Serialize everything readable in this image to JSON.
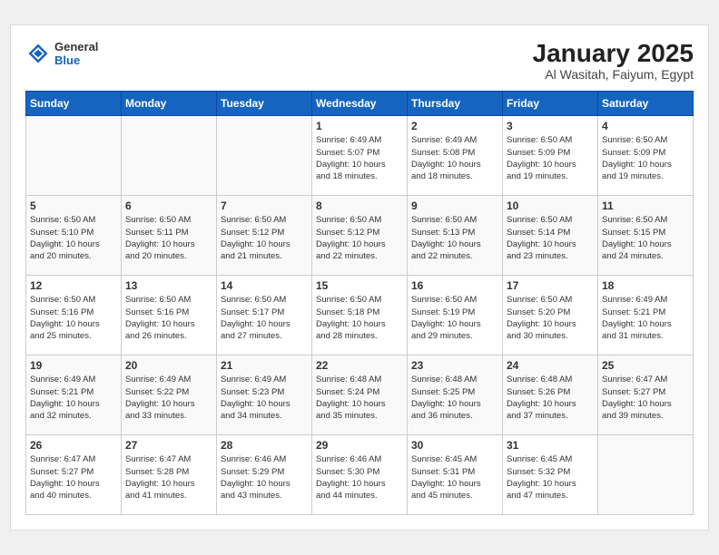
{
  "header": {
    "logo": {
      "general": "General",
      "blue": "Blue"
    },
    "title": "January 2025",
    "location": "Al Wasitah, Faiyum, Egypt"
  },
  "weekdays": [
    "Sunday",
    "Monday",
    "Tuesday",
    "Wednesday",
    "Thursday",
    "Friday",
    "Saturday"
  ],
  "weeks": [
    [
      {
        "day": "",
        "info": ""
      },
      {
        "day": "",
        "info": ""
      },
      {
        "day": "",
        "info": ""
      },
      {
        "day": "1",
        "info": "Sunrise: 6:49 AM\nSunset: 5:07 PM\nDaylight: 10 hours\nand 18 minutes."
      },
      {
        "day": "2",
        "info": "Sunrise: 6:49 AM\nSunset: 5:08 PM\nDaylight: 10 hours\nand 18 minutes."
      },
      {
        "day": "3",
        "info": "Sunrise: 6:50 AM\nSunset: 5:09 PM\nDaylight: 10 hours\nand 19 minutes."
      },
      {
        "day": "4",
        "info": "Sunrise: 6:50 AM\nSunset: 5:09 PM\nDaylight: 10 hours\nand 19 minutes."
      }
    ],
    [
      {
        "day": "5",
        "info": "Sunrise: 6:50 AM\nSunset: 5:10 PM\nDaylight: 10 hours\nand 20 minutes."
      },
      {
        "day": "6",
        "info": "Sunrise: 6:50 AM\nSunset: 5:11 PM\nDaylight: 10 hours\nand 20 minutes."
      },
      {
        "day": "7",
        "info": "Sunrise: 6:50 AM\nSunset: 5:12 PM\nDaylight: 10 hours\nand 21 minutes."
      },
      {
        "day": "8",
        "info": "Sunrise: 6:50 AM\nSunset: 5:12 PM\nDaylight: 10 hours\nand 22 minutes."
      },
      {
        "day": "9",
        "info": "Sunrise: 6:50 AM\nSunset: 5:13 PM\nDaylight: 10 hours\nand 22 minutes."
      },
      {
        "day": "10",
        "info": "Sunrise: 6:50 AM\nSunset: 5:14 PM\nDaylight: 10 hours\nand 23 minutes."
      },
      {
        "day": "11",
        "info": "Sunrise: 6:50 AM\nSunset: 5:15 PM\nDaylight: 10 hours\nand 24 minutes."
      }
    ],
    [
      {
        "day": "12",
        "info": "Sunrise: 6:50 AM\nSunset: 5:16 PM\nDaylight: 10 hours\nand 25 minutes."
      },
      {
        "day": "13",
        "info": "Sunrise: 6:50 AM\nSunset: 5:16 PM\nDaylight: 10 hours\nand 26 minutes."
      },
      {
        "day": "14",
        "info": "Sunrise: 6:50 AM\nSunset: 5:17 PM\nDaylight: 10 hours\nand 27 minutes."
      },
      {
        "day": "15",
        "info": "Sunrise: 6:50 AM\nSunset: 5:18 PM\nDaylight: 10 hours\nand 28 minutes."
      },
      {
        "day": "16",
        "info": "Sunrise: 6:50 AM\nSunset: 5:19 PM\nDaylight: 10 hours\nand 29 minutes."
      },
      {
        "day": "17",
        "info": "Sunrise: 6:50 AM\nSunset: 5:20 PM\nDaylight: 10 hours\nand 30 minutes."
      },
      {
        "day": "18",
        "info": "Sunrise: 6:49 AM\nSunset: 5:21 PM\nDaylight: 10 hours\nand 31 minutes."
      }
    ],
    [
      {
        "day": "19",
        "info": "Sunrise: 6:49 AM\nSunset: 5:21 PM\nDaylight: 10 hours\nand 32 minutes."
      },
      {
        "day": "20",
        "info": "Sunrise: 6:49 AM\nSunset: 5:22 PM\nDaylight: 10 hours\nand 33 minutes."
      },
      {
        "day": "21",
        "info": "Sunrise: 6:49 AM\nSunset: 5:23 PM\nDaylight: 10 hours\nand 34 minutes."
      },
      {
        "day": "22",
        "info": "Sunrise: 6:48 AM\nSunset: 5:24 PM\nDaylight: 10 hours\nand 35 minutes."
      },
      {
        "day": "23",
        "info": "Sunrise: 6:48 AM\nSunset: 5:25 PM\nDaylight: 10 hours\nand 36 minutes."
      },
      {
        "day": "24",
        "info": "Sunrise: 6:48 AM\nSunset: 5:26 PM\nDaylight: 10 hours\nand 37 minutes."
      },
      {
        "day": "25",
        "info": "Sunrise: 6:47 AM\nSunset: 5:27 PM\nDaylight: 10 hours\nand 39 minutes."
      }
    ],
    [
      {
        "day": "26",
        "info": "Sunrise: 6:47 AM\nSunset: 5:27 PM\nDaylight: 10 hours\nand 40 minutes."
      },
      {
        "day": "27",
        "info": "Sunrise: 6:47 AM\nSunset: 5:28 PM\nDaylight: 10 hours\nand 41 minutes."
      },
      {
        "day": "28",
        "info": "Sunrise: 6:46 AM\nSunset: 5:29 PM\nDaylight: 10 hours\nand 43 minutes."
      },
      {
        "day": "29",
        "info": "Sunrise: 6:46 AM\nSunset: 5:30 PM\nDaylight: 10 hours\nand 44 minutes."
      },
      {
        "day": "30",
        "info": "Sunrise: 6:45 AM\nSunset: 5:31 PM\nDaylight: 10 hours\nand 45 minutes."
      },
      {
        "day": "31",
        "info": "Sunrise: 6:45 AM\nSunset: 5:32 PM\nDaylight: 10 hours\nand 47 minutes."
      },
      {
        "day": "",
        "info": ""
      }
    ]
  ]
}
